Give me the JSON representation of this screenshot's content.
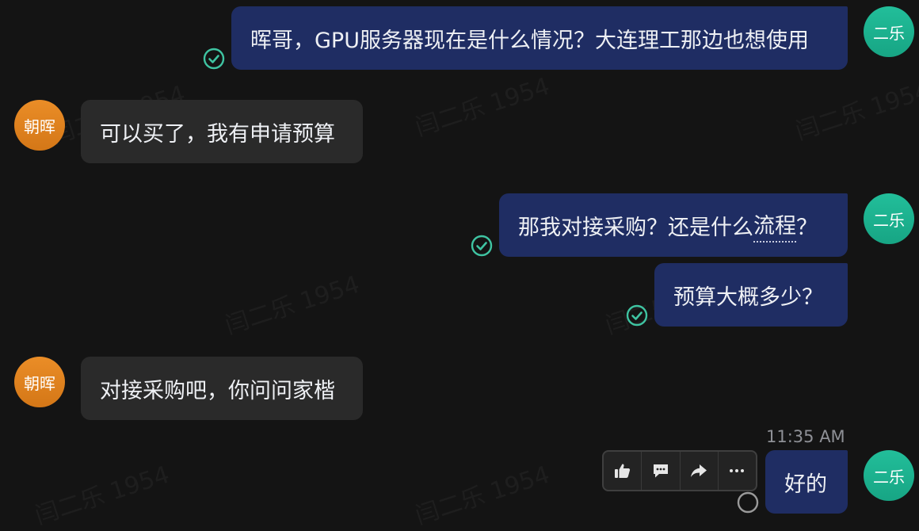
{
  "watermark": "闫二乐 1954",
  "colors": {
    "background": "#141414",
    "outgoing_bubble": "#1f2d63",
    "incoming_bubble": "#2a2a2a",
    "avatar_self": "#1db391",
    "avatar_other": "#e0821f",
    "read_check": "#3fc4a2"
  },
  "users": {
    "self": {
      "avatar_text": "二乐"
    },
    "other": {
      "avatar_text": "朝晖"
    }
  },
  "messages": [
    {
      "sender": "self",
      "text": "晖哥，GPU服务器现在是什么情况？大连理工那边也想使用",
      "status": "read"
    },
    {
      "sender": "other",
      "text": "可以买了，我有申请预算"
    },
    {
      "sender": "self",
      "text_before": "那我对接采购？还是什么",
      "text_underlined": "流程",
      "text_after": "？",
      "status": "read"
    },
    {
      "sender": "self",
      "text": "预算大概多少？",
      "status": "read"
    },
    {
      "sender": "other",
      "text": "对接采购吧，你问问家楷"
    },
    {
      "sender": "self",
      "text": "好的",
      "status": "sending",
      "time": "11:35 AM"
    }
  ],
  "hover_actions": {
    "like": "thumbs-up-icon",
    "comment": "comment-icon",
    "forward": "forward-icon",
    "more": "more-icon"
  }
}
